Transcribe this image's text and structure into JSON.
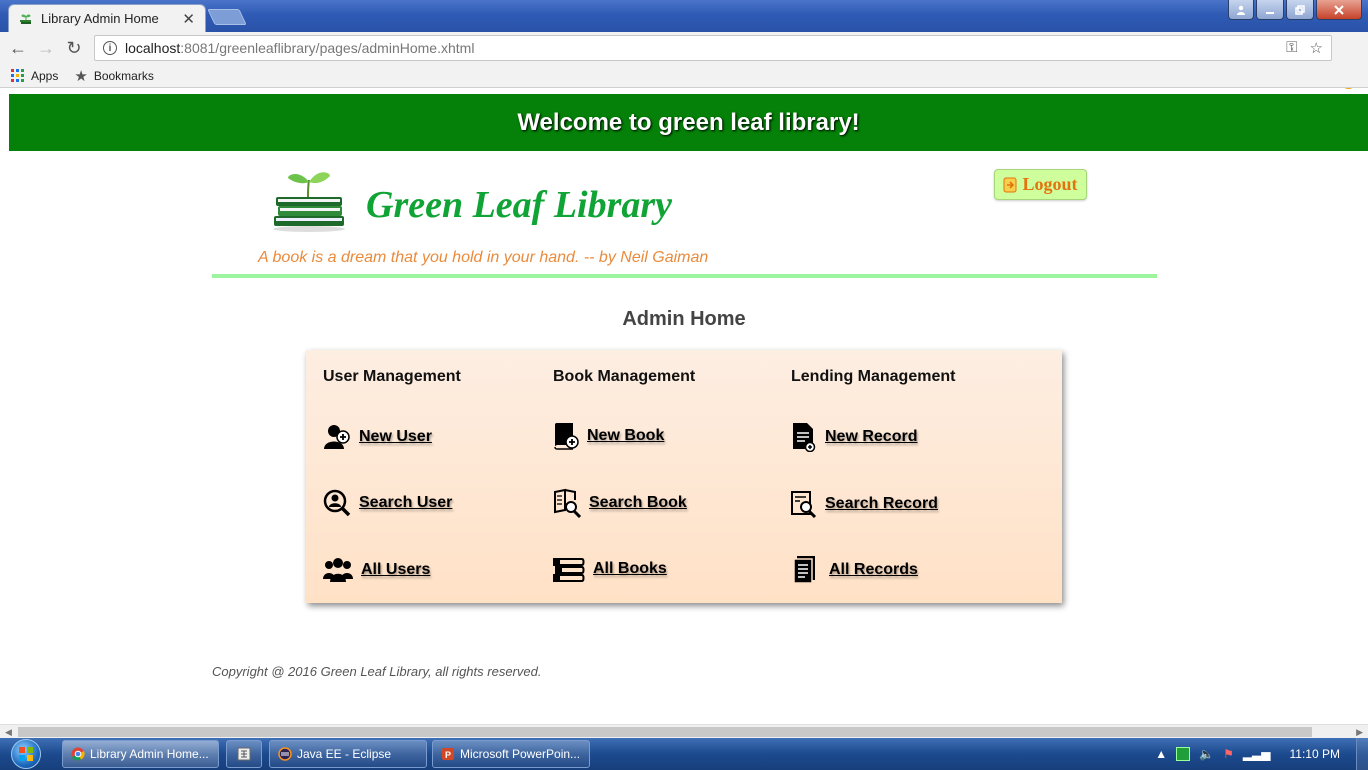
{
  "browser": {
    "tab_title": "Library Admin Home",
    "tab_close": "✕",
    "url_host": "localhost",
    "url_path": ":8081/greenleaflibrary/pages/adminHome.xhtml",
    "bookmarks": [
      {
        "label": "Apps",
        "icon": "apps-grid-icon"
      },
      {
        "label": "Bookmarks",
        "icon": "star-icon"
      }
    ]
  },
  "page": {
    "banner": "Welcome to green leaf library!",
    "site_title": "Green Leaf Library",
    "quote": "A book is a dream that you hold in your hand. -- by Neil Gaiman",
    "logout_label": "Logout",
    "heading": "Admin Home",
    "columns": [
      {
        "title": "User Management",
        "items": [
          {
            "label": "New User",
            "icon": "add-user-icon"
          },
          {
            "label": "Search User",
            "icon": "search-user-icon"
          },
          {
            "label": "All Users",
            "icon": "users-group-icon"
          }
        ]
      },
      {
        "title": "Book Management",
        "items": [
          {
            "label": "New Book",
            "icon": "add-book-icon"
          },
          {
            "label": "Search Book",
            "icon": "search-book-icon"
          },
          {
            "label": "All Books",
            "icon": "books-stack-icon"
          }
        ]
      },
      {
        "title": "Lending Management",
        "items": [
          {
            "label": "New Record",
            "icon": "add-record-icon"
          },
          {
            "label": "Search Record",
            "icon": "search-record-icon"
          },
          {
            "label": "All Records",
            "icon": "records-icon"
          }
        ]
      }
    ],
    "copyright": "Copyright @ 2016 Green Leaf Library, all rights reserved."
  },
  "taskbar": {
    "tasks": [
      {
        "label": "Library Admin Home...",
        "icon": "chrome-icon"
      },
      {
        "label": "",
        "icon": "calculator-icon"
      },
      {
        "label": "Java EE - Eclipse",
        "icon": "eclipse-icon"
      },
      {
        "label": "Microsoft PowerPoin...",
        "icon": "powerpoint-icon"
      }
    ],
    "clock": "11:10 PM"
  },
  "colors": {
    "banner": "#058008",
    "title_green": "#10a335",
    "quote_orange": "#ea8a3c",
    "divider": "#9cf59c",
    "panel_bg": "#ffe1c6"
  }
}
